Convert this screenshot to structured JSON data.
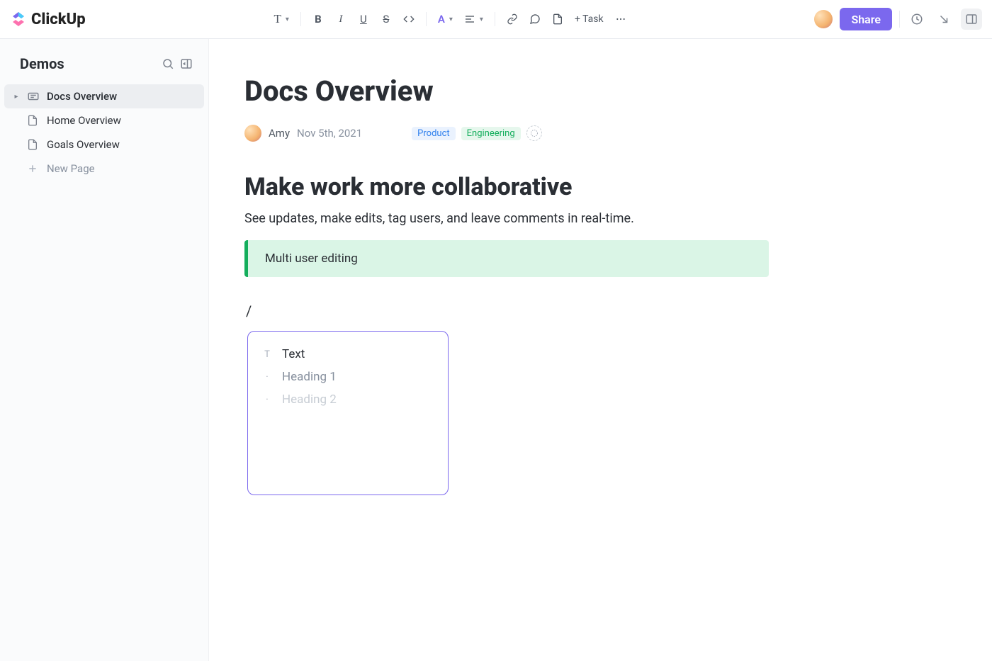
{
  "brand": "ClickUp",
  "toolbar": {
    "type_label": "T",
    "task_label": "+ Task"
  },
  "topright": {
    "share_label": "Share"
  },
  "sidebar": {
    "title": "Demos",
    "items": [
      {
        "label": "Docs Overview",
        "active": true
      },
      {
        "label": "Home Overview",
        "active": false
      },
      {
        "label": "Goals Overview",
        "active": false
      }
    ],
    "new_page_label": "New Page"
  },
  "doc": {
    "title": "Docs Overview",
    "author": "Amy",
    "date": "Nov 5th, 2021",
    "tags": [
      {
        "label": "Product",
        "kind": "product"
      },
      {
        "label": "Engineering",
        "kind": "eng"
      }
    ],
    "heading": "Make work more collaborative",
    "paragraph": "See updates, make edits, tag users, and leave comments in real-time.",
    "callout": "Multi user editing",
    "slash_char": "/",
    "slash_menu": [
      {
        "label": "Text"
      },
      {
        "label": "Heading 1"
      },
      {
        "label": "Heading 2"
      }
    ]
  }
}
